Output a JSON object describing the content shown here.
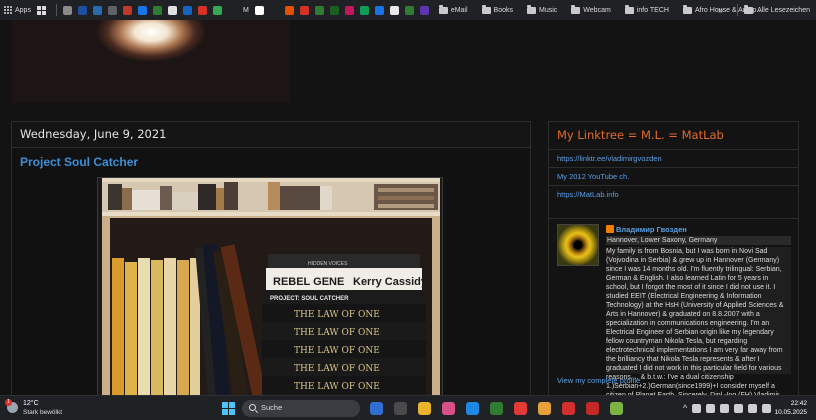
{
  "bookmarks_bar": {
    "apps_label": "Apps",
    "favicons": [
      "#8a8a8a",
      "#1e4fa0",
      "#2b6cb0",
      "#5f6368",
      "#c0392b",
      "#1a73e8",
      "#2e7d32",
      "#e0e0e0",
      "#1565c0",
      "#d93025",
      "#34a853",
      "#202124",
      "#ffffff",
      "#202124",
      "#e65100",
      "#d93025",
      "#2e7d32",
      "#1b5e20",
      "#c2185b",
      "#0f9d58",
      "#1a73e8",
      "#e8e8e8",
      "#2e7d32",
      "#5e35b1"
    ],
    "m_label": "M",
    "folders": [
      "eMail",
      "Books",
      "Music",
      "Webcam",
      "info TECH",
      "Afro House & Amap..."
    ],
    "overflow_label": "»",
    "all_bookmarks_label": "Alle Lesezeichen"
  },
  "post": {
    "date_header": "Wednesday, June 9, 2021",
    "title": "Project Soul Catcher",
    "image_alt": "bookshelf"
  },
  "book_spines": {
    "rebel_gene": "REBEL GENE",
    "kerry_cassidy": "Kerry Cassidy",
    "project_soul_catcher": "PROJECT: SOUL CATCHER",
    "law_of_one": "THE LAW OF ONE",
    "hidden_voices": "HIDDEN VOICES"
  },
  "sidebar": {
    "linktree_title": "My Linktree = M.L. = MatLab",
    "links": [
      "https://linktr.ee/vladimirgvozden",
      "My 2012 YouTube ch.",
      "https://MatLab.info"
    ],
    "profile": {
      "name": "Владимир Гвозден",
      "location": "Hannover, Lower Saxony, Germany",
      "about": "My family is from Bosnia, but I was born in Novi Sad (Vojvodina in Serbia) & grew up in Hannover (Germany) since I was 14 months old. I'm fluently trilingual: Serbian, German & English. I also learned Latin for 5 years in school, but I forgot the most of it since I did not use it. I studied EEIT (Electrical Engineering & Information Technology) at the HsH (University of Applied Sciences & Arts in Hannover) & graduated on 8.8.2007 with a specialization in communications engineering. I'm an Electrical Engineer of Serbian origin like my legendary fellow countryman Nikola Tesla, but regarding electrotechnical implementations I am very far away from the brilliancy that Nikola Tesla represents & after I graduated I did not work in this particular field for various reasons ... & b.t.w.: I've a dual citizenship 1.)Serbian+2.)German(since1999)+I consider myself a citizen of Planet Earth. Sincerely, Dipl.-Ing.(FH) Vladimir Gvozden",
      "view_profile": "View my complete profile"
    }
  },
  "taskbar": {
    "weather_temp": "12°C",
    "weather_condition": "Stark bewölkt",
    "weather_badge": "1",
    "search_label": "Suche",
    "time": "22:42",
    "date": "10.05.2025",
    "app_colors": [
      "#2f6fd1",
      "#4a4a4a",
      "#e9b32b",
      "#d94f8a",
      "#1e88e5",
      "#2e7d32",
      "#e53935",
      "#e8a13a",
      "#d32f2f",
      "#c62828",
      "#7cb342"
    ]
  },
  "colors": {
    "background": "#131313",
    "link": "#5aa0e6",
    "linktree_title": "#e36a2e",
    "post_title": "#3d8fd6"
  }
}
